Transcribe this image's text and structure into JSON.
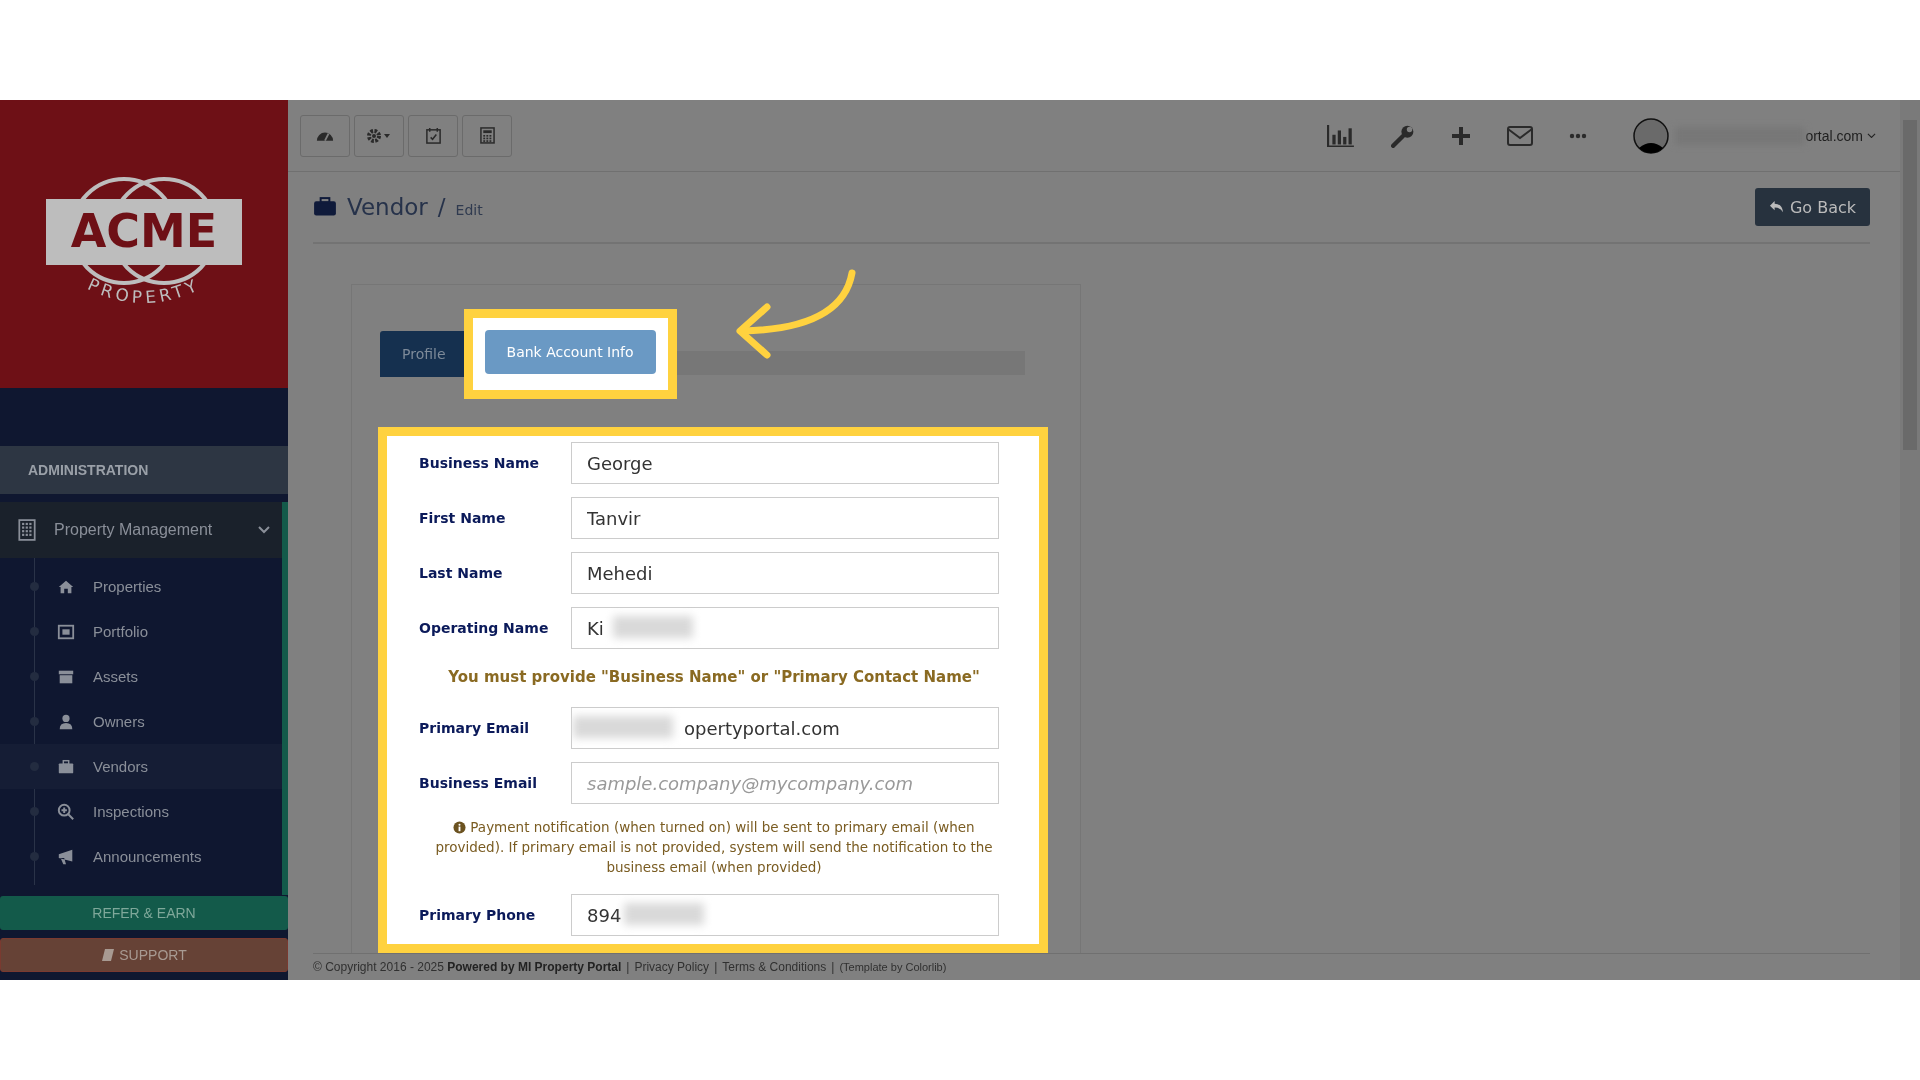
{
  "logo": {
    "name": "ACME",
    "tagline": "PROPERTY"
  },
  "sidebar": {
    "section": "ADMINISTRATION",
    "group": {
      "label": "Property Management",
      "expanded": true
    },
    "items": [
      {
        "label": "Properties",
        "selected": false
      },
      {
        "label": "Portfolio",
        "selected": false
      },
      {
        "label": "Assets",
        "selected": false
      },
      {
        "label": "Owners",
        "selected": false
      },
      {
        "label": "Vendors",
        "selected": true
      },
      {
        "label": "Inspections",
        "selected": false
      },
      {
        "label": "Announcements",
        "selected": false
      }
    ],
    "buttons": [
      {
        "label": "REFER & EARN",
        "kind": "refer"
      },
      {
        "label": "SUPPORT",
        "kind": "support"
      }
    ]
  },
  "user": {
    "email": "ortal.com"
  },
  "header": {
    "title": "Vendor",
    "separator": "/",
    "subtitle": "Edit",
    "back_button": "Go Back"
  },
  "tabs": [
    {
      "label": "Profile",
      "selected": true,
      "highlighted": false
    },
    {
      "label": "Bank Account Info",
      "selected": false,
      "highlighted": true
    }
  ],
  "form": {
    "fields": [
      {
        "label": "Business Name",
        "value": "George",
        "blurred_start": false,
        "blurred_end": false
      },
      {
        "label": "First Name",
        "value": "Tanvir",
        "blurred_start": false,
        "blurred_end": false
      },
      {
        "label": "Last Name",
        "value": "Mehedi",
        "blurred_start": false,
        "blurred_end": false
      },
      {
        "label": "Operating Name",
        "value": "Ki",
        "blurred_start": false,
        "blurred_end": true
      },
      {
        "kind": "warning",
        "text": "You must provide \"Business Name\" or \"Primary Contact Name\""
      },
      {
        "label": "Primary Email",
        "value": "opertyportal.com",
        "blurred_start": true,
        "blurred_end": false
      },
      {
        "label": "Business Email",
        "placeholder": "sample.company@mycompany.com",
        "blurred_start": false,
        "blurred_end": false
      },
      {
        "kind": "note",
        "text": "Payment notification (when turned on) will be sent to primary email (when provided). If primary email is not provided, system will send the notification to the business email (when provided)"
      },
      {
        "label": "Primary Phone",
        "value": "894",
        "blurred_start": false,
        "blurred_end": true
      }
    ]
  },
  "footer": {
    "copyright": "© Copyright 2016 - 2025 **Powered by MI Property Portal**",
    "links": [
      "Privacy Policy",
      "Terms & Conditions"
    ],
    "separator": "|",
    "template": "(Template by Colorlib)"
  }
}
